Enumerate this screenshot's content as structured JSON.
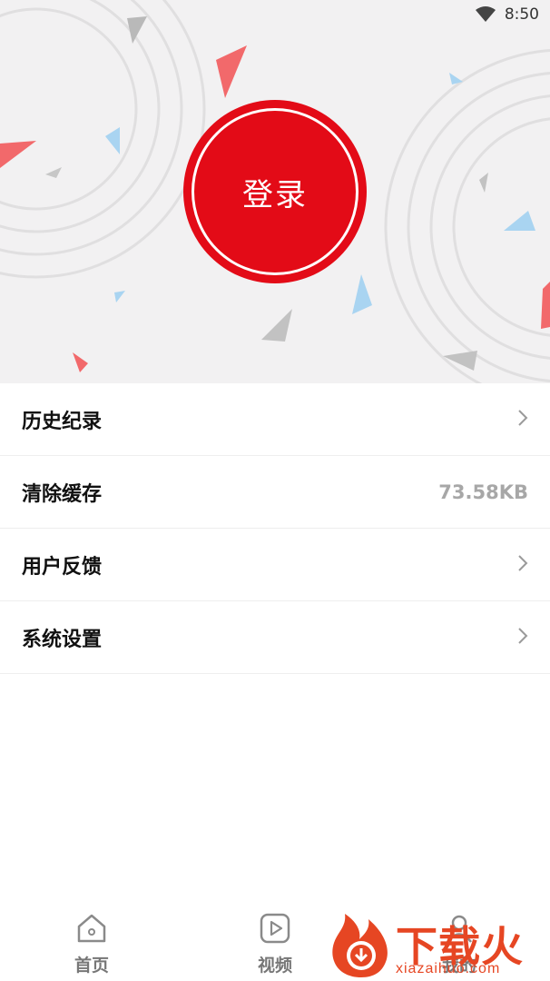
{
  "status_bar": {
    "time": "8:50",
    "wifi_icon": "wifi-icon"
  },
  "header": {
    "login_label": "登录",
    "accent_color": "#e30b17"
  },
  "menu": {
    "items": [
      {
        "label": "历史纪录",
        "trailing": "chevron-right-icon",
        "value": ""
      },
      {
        "label": "清除缓存",
        "trailing": "",
        "value": "73.58KB"
      },
      {
        "label": "用户反馈",
        "trailing": "chevron-right-icon",
        "value": ""
      },
      {
        "label": "系统设置",
        "trailing": "chevron-right-icon",
        "value": ""
      }
    ]
  },
  "bottom_nav": {
    "items": [
      {
        "label": "首页",
        "icon": "home-icon"
      },
      {
        "label": "视频",
        "icon": "play-icon"
      },
      {
        "label": "我的",
        "icon": "user-icon"
      }
    ]
  },
  "watermark": {
    "brand": "下载火",
    "url": "xiazaihuo.com",
    "color": "#e64623"
  }
}
